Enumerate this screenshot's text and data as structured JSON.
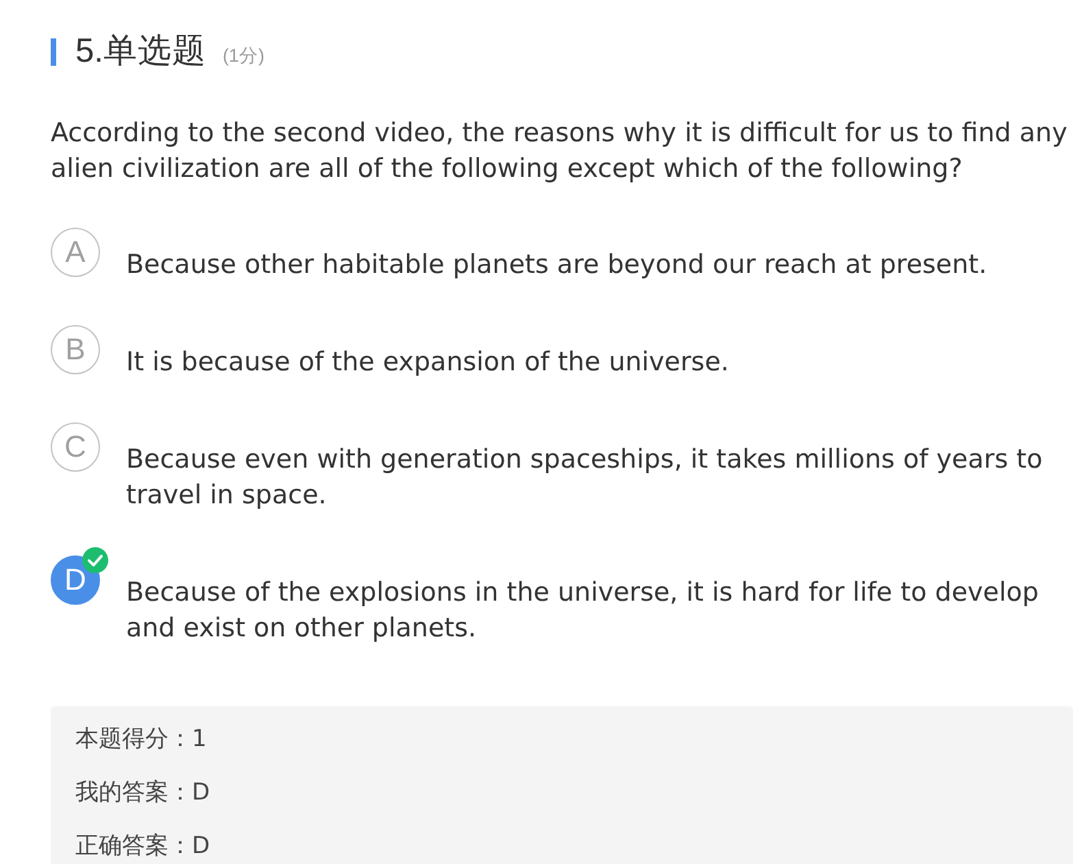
{
  "question": {
    "number": "5.单选题",
    "score": "(1分)",
    "text": "According to the second video, the reasons why it is difficult for us to find any alien civilization are all of the following except which of the following?"
  },
  "options": [
    {
      "letter": "A",
      "text": "Because other habitable planets are beyond our reach at present.",
      "selected": false,
      "correct": false
    },
    {
      "letter": "B",
      "text": "It is because of the expansion of the universe.",
      "selected": false,
      "correct": false
    },
    {
      "letter": "C",
      "text": "Because even with generation spaceships, it takes millions of years to travel in space.",
      "selected": false,
      "correct": false
    },
    {
      "letter": "D",
      "text": "Because of the explosions in the universe, it is hard for life to develop and exist on other planets.",
      "selected": true,
      "correct": true
    }
  ],
  "result": [
    "本题得分：1",
    "我的答案：D",
    "正确答案：D"
  ]
}
